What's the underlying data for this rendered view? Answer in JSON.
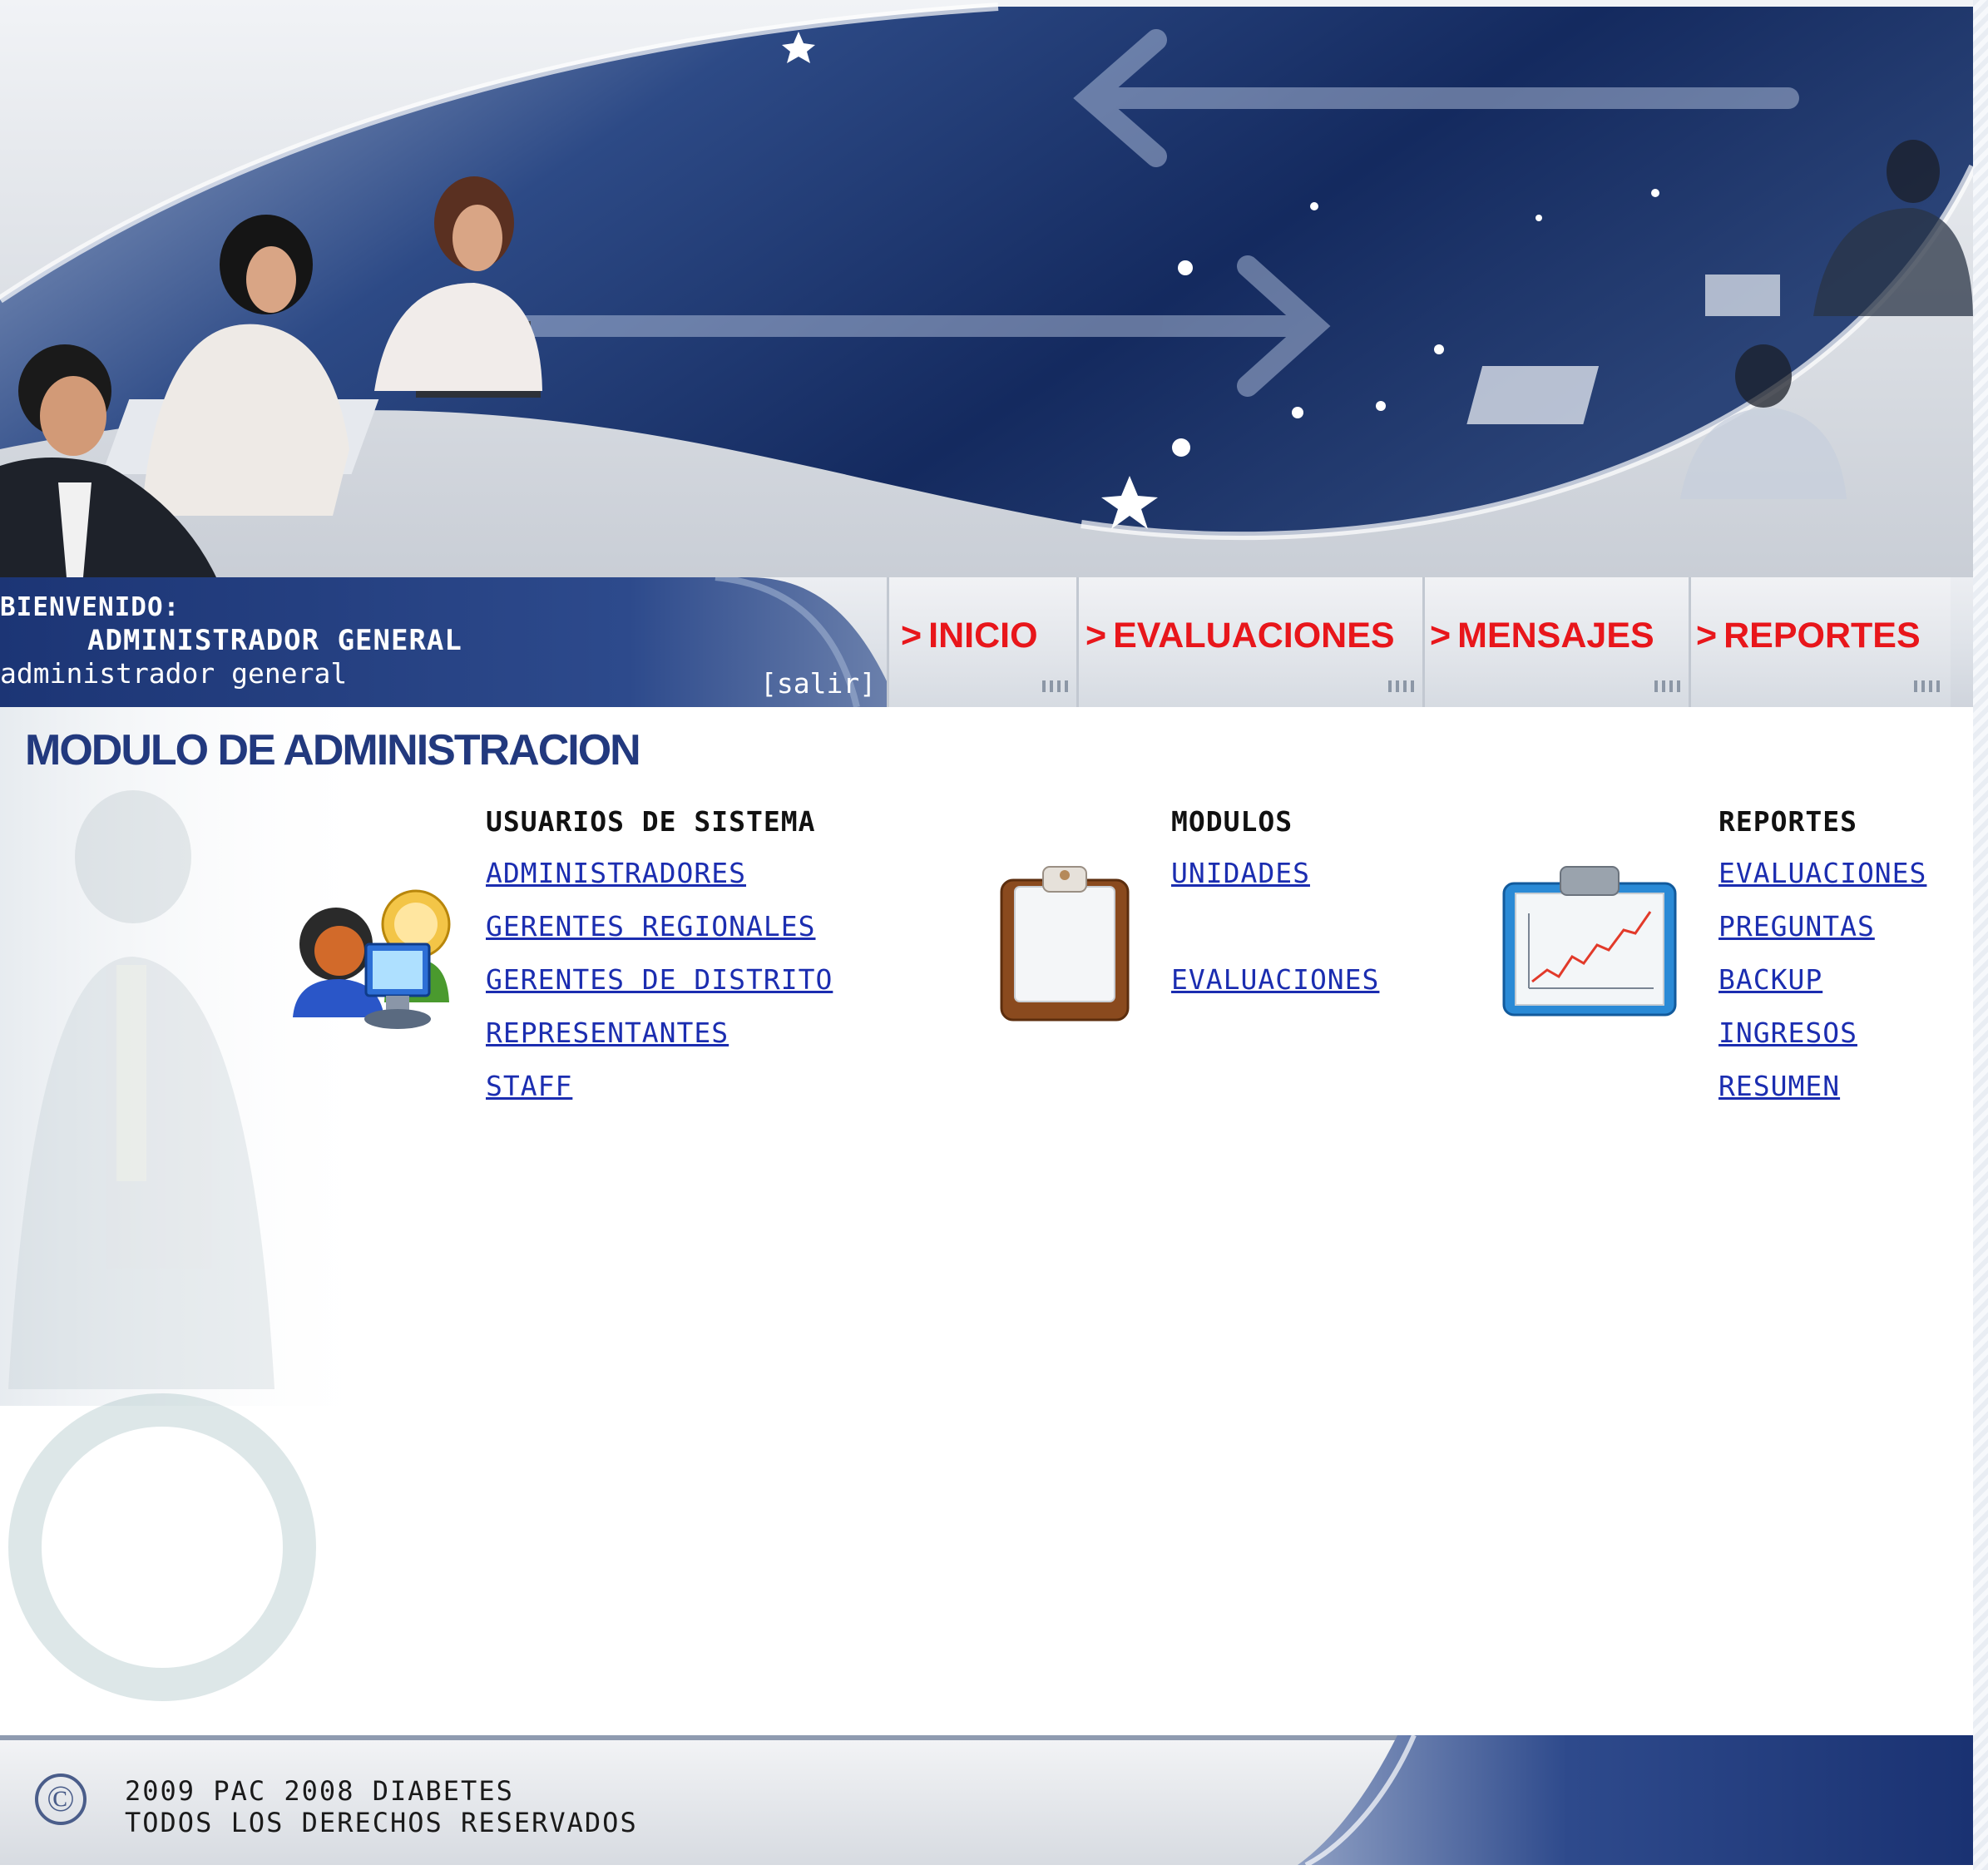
{
  "header": {
    "welcome_label": "BIENVENIDO:",
    "user_role": "ADMINISTRADOR GENERAL",
    "user_name": "administrador general",
    "logout_label": "[salir]"
  },
  "nav": {
    "items": [
      {
        "label": "INICIO"
      },
      {
        "label": "EVALUACIONES"
      },
      {
        "label": "MENSAJES"
      },
      {
        "label": "REPORTES"
      }
    ]
  },
  "main": {
    "title": "MODULO DE ADMINISTRACION",
    "sections": [
      {
        "heading": "USUARIOS DE SISTEMA",
        "icon": "users-computer-icon",
        "links": [
          "ADMINISTRADORES",
          "GERENTES REGIONALES",
          "GERENTES DE DISTRITO",
          "REPRESENTANTES",
          "STAFF"
        ]
      },
      {
        "heading": "MODULOS",
        "icon": "clipboard-icon",
        "links": [
          "UNIDADES",
          "EVALUACIONES"
        ]
      },
      {
        "heading": "REPORTES",
        "icon": "chart-clipboard-icon",
        "links": [
          "EVALUACIONES",
          "PREGUNTAS",
          "BACKUP",
          "INGRESOS",
          "RESUMEN"
        ]
      }
    ]
  },
  "footer": {
    "line1": "2009 PAC 2008 DIABETES",
    "line2": "TODOS LOS DERECHOS RESERVADOS"
  },
  "colors": {
    "nav_text": "#e8161b",
    "title": "#22397e",
    "link": "#1b2db0",
    "header_blue": "#1c3575"
  }
}
